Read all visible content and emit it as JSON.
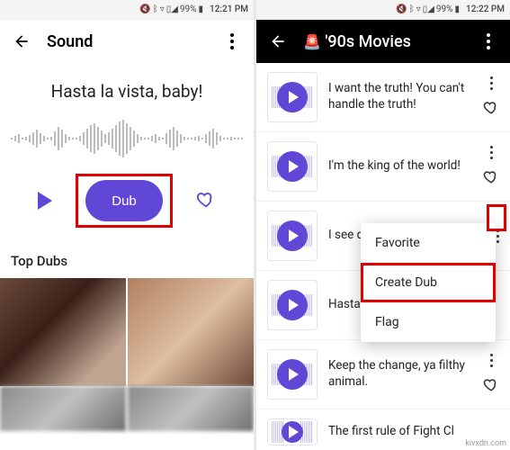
{
  "status": {
    "battery": "99%",
    "time_left": "12:21 PM",
    "time_right": "12:22 PM"
  },
  "left": {
    "title": "Sound",
    "sound_title": "Hasta la vista, baby!",
    "dub_label": "Dub",
    "section": "Top Dubs"
  },
  "right": {
    "title_emoji": "🚨",
    "title": "'90s Movies",
    "items": [
      {
        "text": "I want the truth! You can't handle the truth!"
      },
      {
        "text": "I'm the king of the world!"
      },
      {
        "text": "I see dead people."
      },
      {
        "text": "Hasta l"
      },
      {
        "text": "Keep the change, ya filthy animal."
      },
      {
        "text": "The first rule of Fight Cl"
      }
    ],
    "menu": {
      "favorite": "Favorite",
      "create_dub": "Create Dub",
      "flag": "Flag"
    }
  },
  "watermark": "kivxdn.com",
  "colors": {
    "accent": "#6047d6",
    "highlight": "#e00000"
  }
}
